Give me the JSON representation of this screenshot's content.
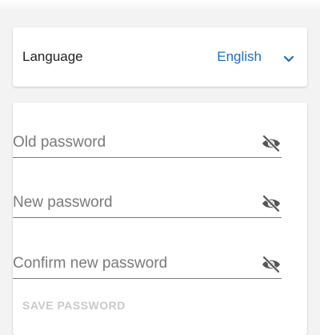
{
  "language": {
    "label": "Language",
    "selected": "English",
    "accent_color": "#1e6fbf"
  },
  "password": {
    "old_placeholder": "Old password",
    "new_placeholder": "New password",
    "confirm_placeholder": "Confirm new password",
    "visibility_icon": "eye-off-icon",
    "save_label": "SAVE PASSWORD"
  }
}
